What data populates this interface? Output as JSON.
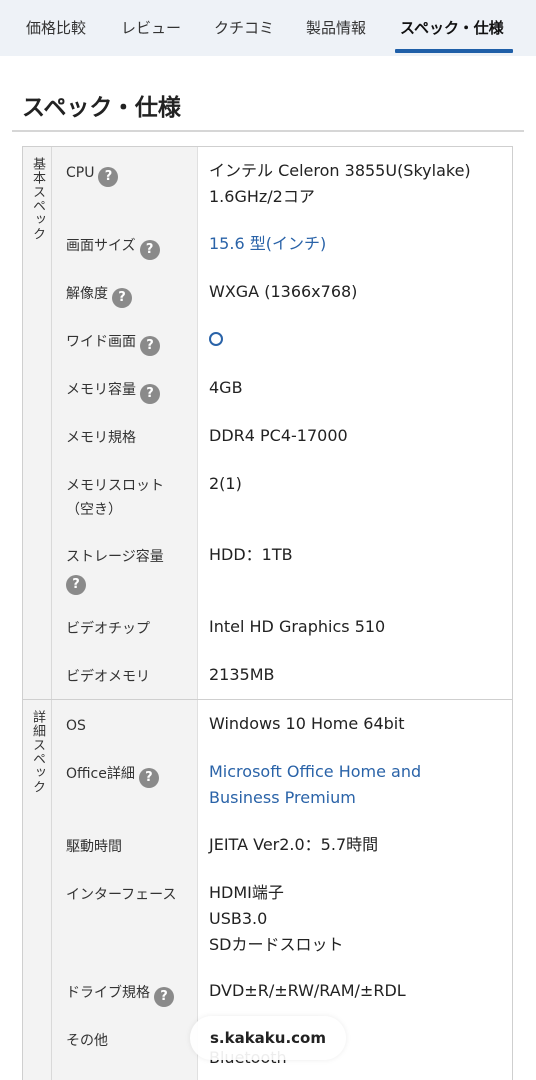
{
  "tabs": [
    {
      "label": "価格比較"
    },
    {
      "label": "レビュー"
    },
    {
      "label": "クチコミ"
    },
    {
      "label": "製品情報"
    },
    {
      "label": "スペック・仕様"
    }
  ],
  "page_title": "スペック・仕様",
  "groups": [
    {
      "label": "基本スペック",
      "rows": [
        {
          "label": "CPU",
          "value": "インテル Celeron 3855U(Skylake) 1.6GHz/2コア"
        },
        {
          "label": "画面サイズ",
          "value": "15.6 型(インチ)"
        },
        {
          "label": "解像度",
          "value": "WXGA (1366x768)"
        },
        {
          "label": "ワイド画面",
          "value": "○"
        },
        {
          "label": "メモリ容量",
          "value": "4GB"
        },
        {
          "label": "メモリ規格",
          "value": "DDR4 PC4-17000"
        },
        {
          "label": "メモリスロット（空き）",
          "value": "2(1)"
        },
        {
          "label": "ストレージ容量",
          "value": "HDD：1TB"
        },
        {
          "label": "ビデオチップ",
          "value": "Intel HD Graphics 510"
        },
        {
          "label": "ビデオメモリ",
          "value": "2135MB"
        }
      ]
    },
    {
      "label": "詳細スペック",
      "rows": [
        {
          "label": "OS",
          "value": "Windows 10 Home 64bit"
        },
        {
          "label": "Office詳細",
          "value": "Microsoft Office Home and Business Premium"
        },
        {
          "label": "駆動時間",
          "value": "JEITA Ver2.0：5.7時間"
        },
        {
          "label": "インターフェース",
          "value_lines": [
            "HDMI端子",
            "USB3.0",
            "SDカードスロット"
          ]
        },
        {
          "label": "ドライブ規格",
          "value": "DVD±R/±RW/RAM/±RDL"
        },
        {
          "label": "その他",
          "value": "Bluetooth"
        }
      ]
    }
  ],
  "help_icon": "question-circle-icon",
  "watermark": "s.kakaku.com",
  "colors": {
    "accent": "#1f5fa8",
    "link": "#2a63a8",
    "label_bg": "#f3f3f3",
    "tabbar_bg": "#eef2f7"
  }
}
